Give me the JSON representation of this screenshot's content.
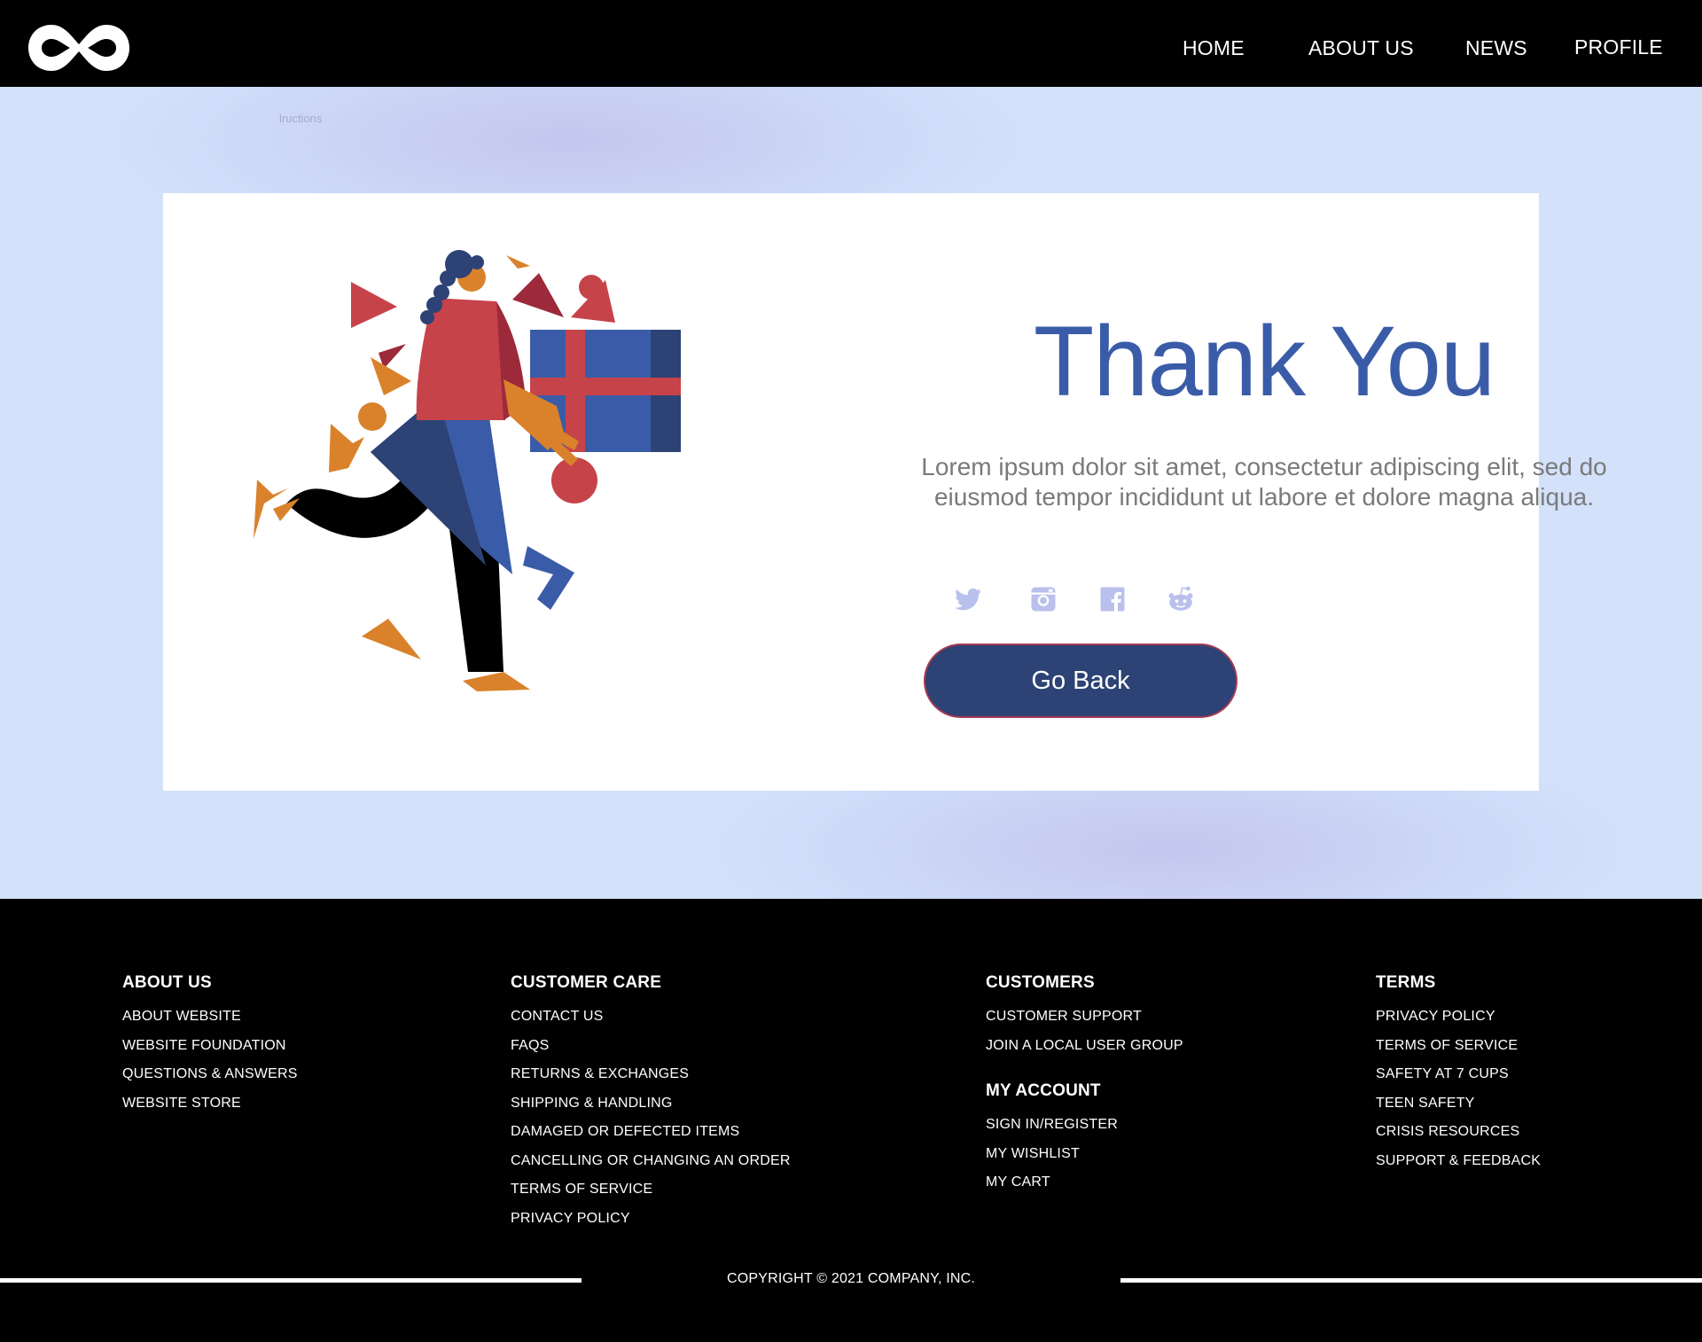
{
  "header": {
    "logo_icon": "infinity-logo-icon",
    "nav": [
      {
        "label": "HOME"
      },
      {
        "label": "ABOUT US"
      },
      {
        "label": "NEWS"
      },
      {
        "label": "PROFILE"
      }
    ]
  },
  "hero": {
    "watermark": "lructions",
    "title": "Thank You",
    "body": "Lorem ipsum dolor sit amet, consectetur adipiscing elit, sed do eiusmod tempor incididunt ut labore et dolore magna aliqua.",
    "social_icons": [
      "twitter-icon",
      "instagram-icon",
      "facebook-icon",
      "reddit-icon"
    ],
    "social_color": "#b9c0ec",
    "button_label": "Go Back",
    "accent": "#3a5ca8",
    "button_color": "#2d4275"
  },
  "footer": {
    "columns": [
      {
        "heading": "ABOUT US",
        "items": [
          "ABOUT WEBSITE",
          "WEBSITE FOUNDATION",
          "QUESTIONS & ANSWERS",
          "WEBSITE STORE"
        ]
      },
      {
        "heading": "CUSTOMER CARE",
        "items": [
          "CONTACT US",
          "FAQS",
          "RETURNS & EXCHANGES",
          "SHIPPING & HANDLING",
          "DAMAGED OR DEFECTED ITEMS",
          "CANCELLING OR CHANGING AN ORDER",
          "TERMS OF SERVICE",
          "PRIVACY POLICY"
        ]
      },
      {
        "heading": "CUSTOMERS",
        "items": [
          "CUSTOMER SUPPORT",
          "JOIN A LOCAL USER GROUP"
        ],
        "heading2": "MY ACCOUNT",
        "items2": [
          "SIGN IN/REGISTER",
          "MY WISHLIST",
          "MY CART"
        ]
      },
      {
        "heading": "TERMS",
        "items": [
          "PRIVACY POLICY",
          "TERMS OF SERVICE",
          "SAFETY AT 7 CUPS",
          "TEEN SAFETY",
          "CRISIS RESOURCES",
          "SUPPORT & FEEDBACK"
        ]
      }
    ],
    "copyright": "COPYRIGHT © 2021 COMPANY, INC."
  }
}
